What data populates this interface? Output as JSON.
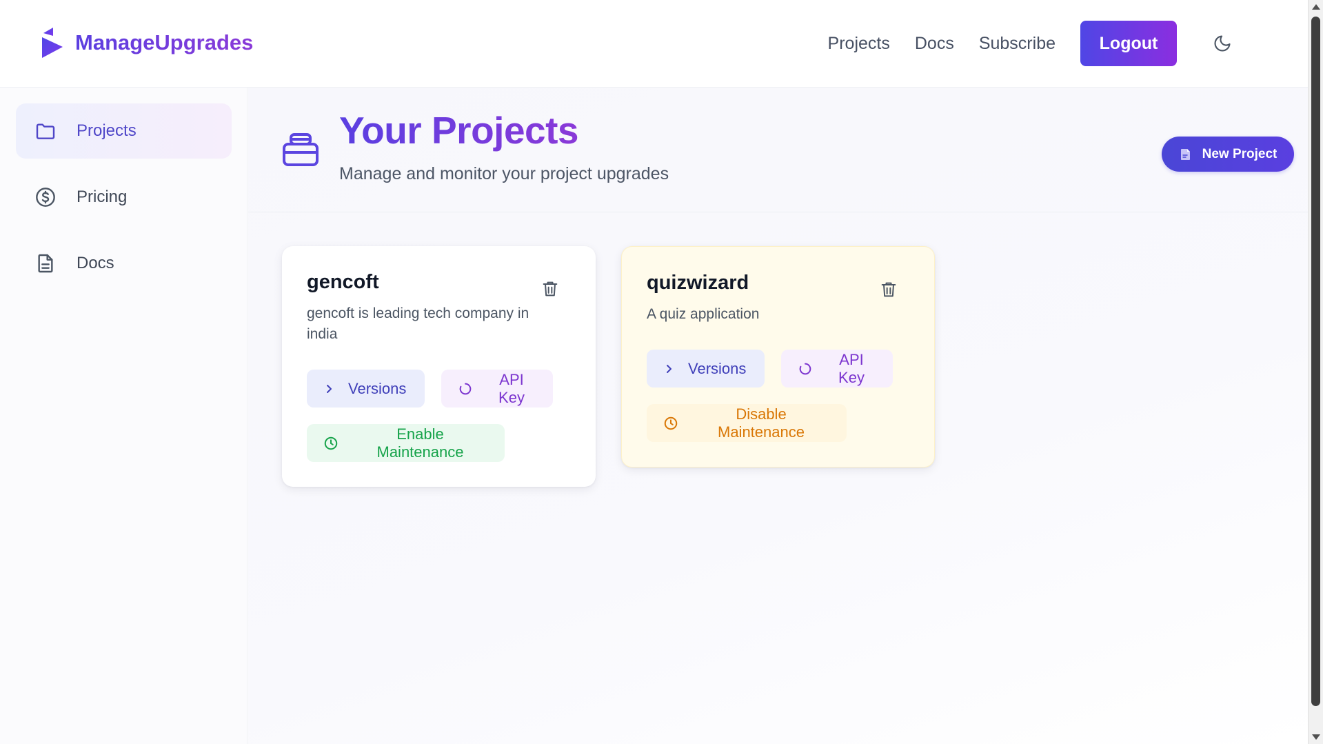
{
  "brand": {
    "name": "ManageUpgrades"
  },
  "topnav": {
    "links": [
      "Projects",
      "Docs",
      "Subscribe"
    ],
    "logout_label": "Logout",
    "theme_icon": "moon-icon"
  },
  "sidebar": {
    "items": [
      {
        "label": "Projects",
        "icon": "folder-icon",
        "active": true
      },
      {
        "label": "Pricing",
        "icon": "dollar-circle-icon",
        "active": false
      },
      {
        "label": "Docs",
        "icon": "document-icon",
        "active": false
      }
    ]
  },
  "page": {
    "title": "Your Projects",
    "subtitle": "Manage and monitor your project upgrades",
    "new_project_label": "New Project"
  },
  "projects": [
    {
      "name": "gencoft",
      "description": "gencoft is leading tech company in india",
      "versions_label": "Versions",
      "api_key_label": "API Key",
      "maintenance_label": "Enable Maintenance",
      "maintenance_mode": false
    },
    {
      "name": "quizwizard",
      "description": "A quiz application",
      "versions_label": "Versions",
      "api_key_label": "API Key",
      "maintenance_label": "Disable Maintenance",
      "maintenance_mode": true
    }
  ],
  "colors": {
    "brand_gradient_start": "#5b3fe0",
    "brand_gradient_end": "#8a3ad8",
    "enable_green": "#16a34a",
    "disable_amber": "#d97706",
    "maintenance_card_bg": "#fffbeb"
  }
}
